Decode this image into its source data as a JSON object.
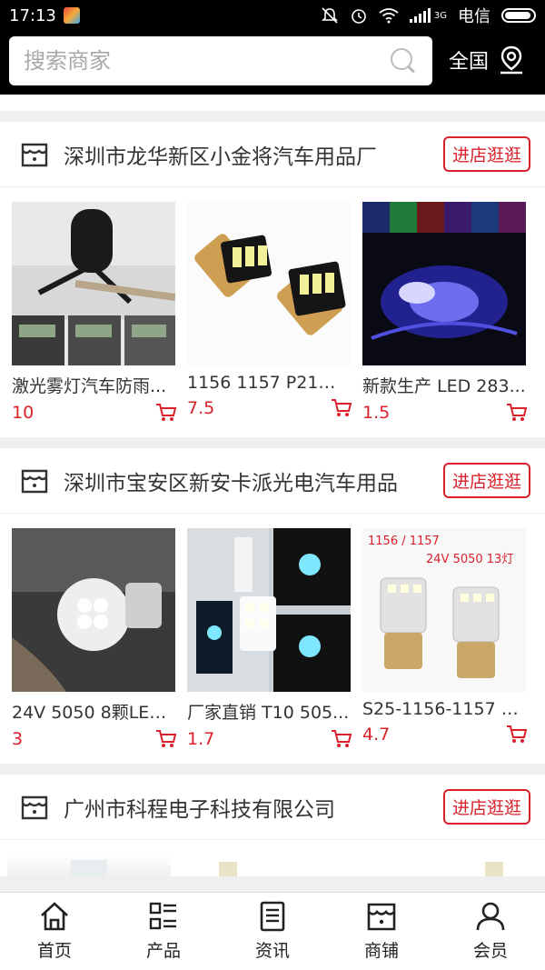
{
  "status_bar": {
    "time": "17:13",
    "carrier": "电信",
    "network": "3G"
  },
  "search": {
    "placeholder": "搜索商家",
    "region_label": "全国"
  },
  "shops": [
    {
      "name": "深圳市龙华新区小金将汽车用品厂",
      "visit_label": "进店逛逛",
      "products": [
        {
          "title": "激光雾灯汽车防雨...",
          "price": "10"
        },
        {
          "title": "1156 1157 P21W ...",
          "price": "7.5"
        },
        {
          "title": "新款生产 LED 283...",
          "price": "1.5"
        }
      ]
    },
    {
      "name": "深圳市宝安区新安卡派光电汽车用品",
      "visit_label": "进店逛逛",
      "products": [
        {
          "title": "24V 5050 8颗LED...",
          "price": "3"
        },
        {
          "title": "厂家直销 T10 505...",
          "price": "1.7"
        },
        {
          "title": "S25-1156-1157 24...",
          "price": "4.7",
          "image_text": [
            "1156 / 1157",
            "24V  5050 13灯"
          ]
        }
      ]
    },
    {
      "name": "广州市科程电子科技有限公司",
      "visit_label": "进店逛逛",
      "products": []
    }
  ],
  "bottom_nav": [
    {
      "label": "首页",
      "icon": "home-icon"
    },
    {
      "label": "产品",
      "icon": "list-icon"
    },
    {
      "label": "资讯",
      "icon": "news-icon"
    },
    {
      "label": "商铺",
      "icon": "store-icon"
    },
    {
      "label": "会员",
      "icon": "user-icon"
    }
  ],
  "colors": {
    "accent": "#d9212c",
    "header_bg": "#000000",
    "page_bg": "#efefef"
  }
}
